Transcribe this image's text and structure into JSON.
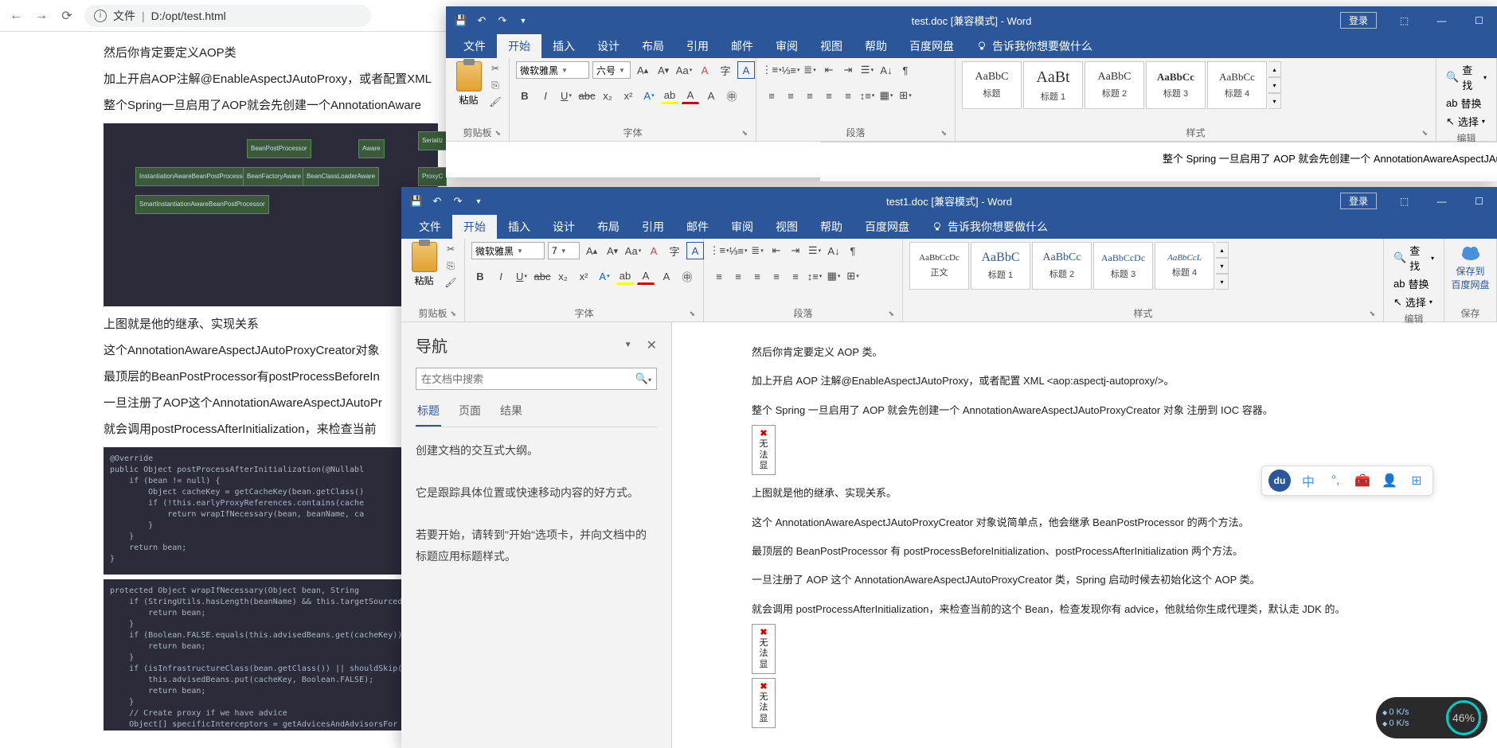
{
  "browser": {
    "label": "文件",
    "url": "D:/opt/test.html"
  },
  "page": {
    "line1": "然后你肯定要定义AOP类",
    "line2": "加上开启AOP注解@EnableAspectJAutoProxy，或者配置XML",
    "line3": "整个Spring一旦启用了AOP就会先创建一个AnnotationAware",
    "line4": "上图就是他的继承、实现关系",
    "line5": "这个AnnotationAwareAspectJAutoProxyCreator对象",
    "line6": "最顶层的BeanPostProcessor有postProcessBeforeIn",
    "line7": "一旦注册了AOP这个AnnotationAwareAspectJAutoPr",
    "line8": "就会调用postProcessAfterInitialization，来检查当前"
  },
  "diagram_nodes": [
    "BeanPostProcessor",
    "Aware",
    "Serializ",
    "InstantiationAwareBeanPostProcessor",
    "BeanFactoryAware",
    "BeanClassLoaderAware",
    "ProxyC",
    "SmartInstantiationAwareBeanPostProcessor"
  ],
  "code1": "@Override\npublic Object postProcessAfterInitialization(@Nullabl\n    if (bean != null) {\n        Object cacheKey = getCacheKey(bean.getClass()\n        if (!this.earlyProxyReferences.contains(cache\n            return wrapIfNecessary(bean, beanName, ca\n        }\n    }\n    return bean;\n}",
  "code2": "protected Object wrapIfNecessary(Object bean, String\n    if (StringUtils.hasLength(beanName) && this.targetSourced\n        return bean;\n    }\n    if (Boolean.FALSE.equals(this.advisedBeans.get(cacheKey))\n        return bean;\n    }\n    if (isInfrastructureClass(bean.getClass()) || shouldSkip(\n        this.advisedBeans.put(cacheKey, Boolean.FALSE);\n        return bean;\n    }\n    // Create proxy if we have advice\n    Object[] specificInterceptors = getAdvicesAndAdvisorsFor",
  "word_back": {
    "title": "test.doc [兼容模式] - Word",
    "login": "登录",
    "doc_snippet": "整个 Spring 一旦启用了 AOP 就会先创建一个 AnnotationAwareAspectJAutoProxyCreator 对象 注册到 IOC 容器"
  },
  "word_front": {
    "title": "test1.doc [兼容模式] - Word",
    "login": "登录"
  },
  "menu": {
    "file": "文件",
    "home": "开始",
    "insert": "插入",
    "design": "设计",
    "layout": "布局",
    "references": "引用",
    "mailings": "邮件",
    "review": "审阅",
    "view": "视图",
    "help": "帮助",
    "baidu": "百度网盘",
    "tell": "告诉我你想要做什么"
  },
  "ribbon": {
    "paste": "粘贴",
    "clipboard": "剪贴板",
    "font_name": "微软雅黑",
    "font_size_back": "六号",
    "font_size_front": "7",
    "font": "字体",
    "paragraph": "段落",
    "styles": "样式",
    "editing": "编辑",
    "find": "查找",
    "replace": "替换",
    "select": "选择",
    "save": "保存",
    "save_to": "保存到",
    "baidu_disk": "百度网盘",
    "style_preview1": "AaBbCcDc",
    "style_preview2": "AaBbC",
    "style_preview3": "AaBbCc",
    "style_preview4": "AaBbCcDc",
    "style_preview5": "AaBbCcL",
    "style_back_p1": "AaBbC",
    "style_back_p2": "AaBt",
    "style_back_p3": "AaBbC",
    "style_back_p4": "AaBbCc",
    "style_back_p5": "AaBbCc",
    "normal": "正文",
    "title_s": "标题",
    "heading1": "标题 1",
    "heading2": "标题 2",
    "heading3": "标题 3",
    "heading4": "标题 4"
  },
  "nav": {
    "title": "导航",
    "search_placeholder": "在文档中搜索",
    "tab_headings": "标题",
    "tab_pages": "页面",
    "tab_results": "结果",
    "body1": "创建文档的交互式大纲。",
    "body2": "它是跟踪具体位置或快速移动内容的好方式。",
    "body3": "若要开始，请转到\"开始\"选项卡，并向文档中的标题应用标题样式。"
  },
  "doc": {
    "p1": "然后你肯定要定义 AOP 类。",
    "p2": "加上开启 AOP 注解@EnableAspectJAutoProxy，或者配置 XML <aop:aspectj-autoproxy/>。",
    "p3": "整个 Spring 一旦启用了 AOP 就会先创建一个 AnnotationAwareAspectJAutoProxyCreator 对象 注册到 IOC 容器。",
    "p4": "上图就是他的继承、实现关系。",
    "p5": "这个 AnnotationAwareAspectJAutoProxyCreator 对象说简单点，他会继承 BeanPostProcessor 的两个方法。",
    "p6": "最顶层的 BeanPostProcessor 有 postProcessBeforeInitialization、postProcessAfterInitialization 两个方法。",
    "p7": "一旦注册了 AOP 这个 AnnotationAwareAspectJAutoProxyCreator 类，Spring 启动时候去初始化这个 AOP 类。",
    "p8": "就会调用 postProcessAfterInitialization，来检查当前的这个 Bean，检查发现你有 advice，他就给你生成代理类，默认走 JDK 的。",
    "img_err": "无法显"
  },
  "net": {
    "up": "0 K/s",
    "down": "0 K/s",
    "pct": "46%"
  }
}
